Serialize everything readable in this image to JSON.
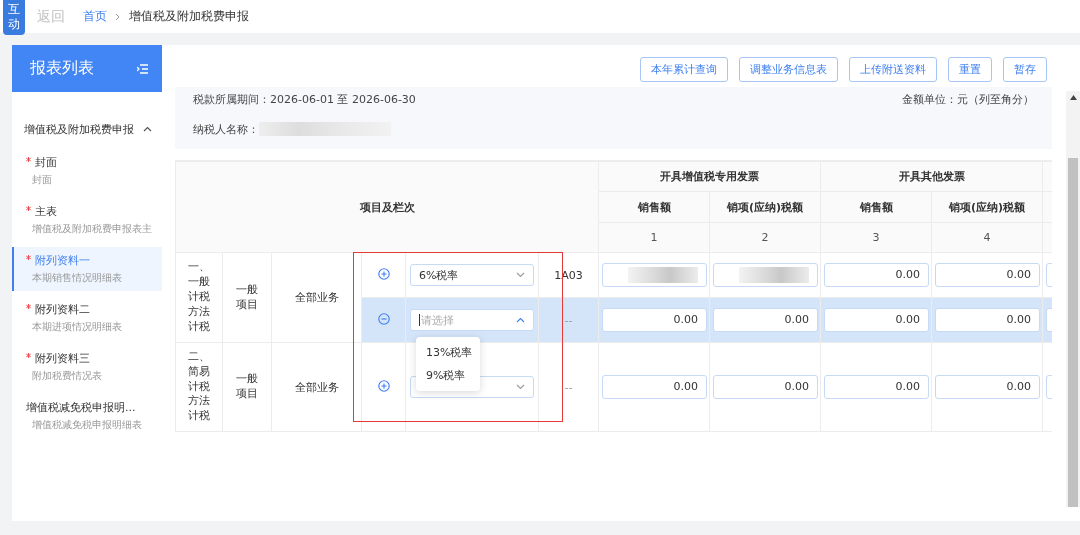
{
  "top_bar": {
    "badge": "互动",
    "back": "返回",
    "breadcrumb": [
      {
        "label": "首页",
        "link": true
      },
      {
        "label": "增值税及附加税费申报",
        "link": false
      }
    ]
  },
  "sidebar": {
    "title": "报表列表",
    "group": {
      "label": "增值税及附加税费申报",
      "expanded": true
    },
    "items": [
      {
        "title": "封面",
        "subtitle": "封面",
        "required": true,
        "selected": false
      },
      {
        "title": "主表",
        "subtitle": "增值税及附加税费申报表主",
        "required": true,
        "selected": false
      },
      {
        "title": "附列资料一",
        "subtitle": "本期销售情况明细表",
        "required": true,
        "selected": true
      },
      {
        "title": "附列资料二",
        "subtitle": "本期进项情况明细表",
        "required": true,
        "selected": false
      },
      {
        "title": "附列资料三",
        "subtitle": "附加税费情况表",
        "required": true,
        "selected": false
      },
      {
        "title": "增值税减免税申报明...",
        "subtitle": "增值税减免税申报明细表",
        "required": false,
        "selected": false
      }
    ]
  },
  "toolbar": {
    "buttons": [
      "本年累计查询",
      "调整业务信息表",
      "上传附送资料",
      "重置",
      "暂存"
    ]
  },
  "info": {
    "period_label": "税款所属期间：",
    "period": "2026-06-01 至 2026-06-30",
    "unit": "金额单位：元（列至角分）",
    "taxpayer_label": "纳税人名称：",
    "taxpayer_blurred": true
  },
  "table": {
    "item_header": "项目及栏次",
    "highlight_frame": true,
    "column_groups": [
      {
        "label": "开具增值税专用发票",
        "columns": [
          {
            "label": "销售额",
            "number": "1"
          },
          {
            "label": "销项(应纳)税额",
            "number": "2"
          }
        ]
      },
      {
        "label": "开具其他发票",
        "columns": [
          {
            "label": "销售额",
            "number": "3"
          },
          {
            "label": "销项(应纳)税额",
            "number": "4"
          }
        ]
      }
    ],
    "groups": [
      {
        "label": "一、一般计税方法计税",
        "item": "一般项目",
        "business": "全部业务",
        "lines": [
          {
            "kind": "add",
            "selected": false,
            "rate": {
              "value": "6%税率",
              "open": false
            },
            "code": "1A03",
            "cells": [
              {
                "kind": "blurred"
              },
              {
                "kind": "blurred"
              },
              {
                "kind": "amount",
                "value": "0.00"
              },
              {
                "kind": "amount",
                "value": "0.00"
              }
            ]
          },
          {
            "kind": "remove",
            "selected": true,
            "rate": {
              "placeholder": "请选择",
              "open": true,
              "options": [
                "13%税率",
                "9%税率"
              ]
            },
            "code": "--",
            "cells": [
              {
                "kind": "amount",
                "value": "0.00"
              },
              {
                "kind": "amount",
                "value": "0.00"
              },
              {
                "kind": "amount",
                "value": "0.00"
              },
              {
                "kind": "amount",
                "value": "0.00"
              }
            ]
          }
        ]
      },
      {
        "label": "二、简易计税方法计税",
        "item": "一般项目",
        "business": "全部业务",
        "lines": [
          {
            "kind": "add",
            "selected": false,
            "rate": {
              "open": false
            },
            "code": "--",
            "cells": [
              {
                "kind": "amount",
                "value": "0.00"
              },
              {
                "kind": "amount",
                "value": "0.00"
              },
              {
                "kind": "amount",
                "value": "0.00"
              },
              {
                "kind": "amount",
                "value": "0.00"
              }
            ]
          }
        ]
      }
    ]
  }
}
